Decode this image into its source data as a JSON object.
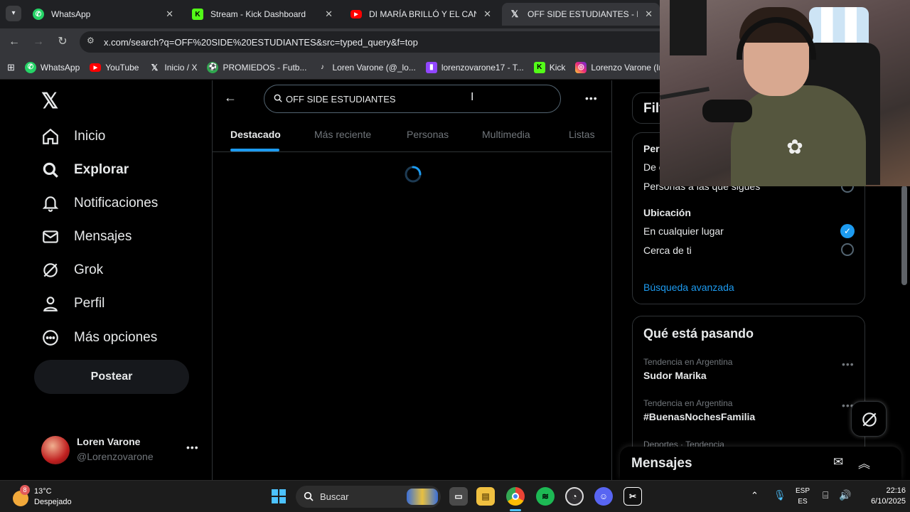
{
  "browser": {
    "tabs": [
      {
        "title": "WhatsApp",
        "favicon": "whatsapp-icon",
        "active": false
      },
      {
        "title": "Stream - Kick Dashboard",
        "favicon": "kick-icon",
        "active": false
      },
      {
        "title": "DI MARÍA BRILLÓ Y EL CANALL",
        "favicon": "youtube-icon",
        "active": false
      },
      {
        "title": "OFF SIDE ESTUDIANTES - Busc",
        "favicon": "x-icon",
        "active": true
      }
    ],
    "url": "x.com/search?q=OFF%20SIDE%20ESTUDIANTES&src=typed_query&f=top",
    "bookmarks": [
      {
        "label": "WhatsApp",
        "icon": "whatsapp-icon"
      },
      {
        "label": "YouTube",
        "icon": "youtube-icon"
      },
      {
        "label": "Inicio / X",
        "icon": "x-icon"
      },
      {
        "label": "PROMIEDOS - Futb...",
        "icon": "promiedos-icon"
      },
      {
        "label": "Loren Varone (@_lo...",
        "icon": "tiktok-icon"
      },
      {
        "label": "lorenzovarone17 - T...",
        "icon": "twitch-icon"
      },
      {
        "label": "Kick",
        "icon": "kick-icon"
      },
      {
        "label": "Lorenzo Varone (Inst...",
        "icon": "instagram-icon"
      }
    ]
  },
  "sidebar": {
    "nav": [
      {
        "label": "Inicio",
        "icon": "home-icon"
      },
      {
        "label": "Explorar",
        "icon": "search-icon"
      },
      {
        "label": "Notificaciones",
        "icon": "bell-icon"
      },
      {
        "label": "Mensajes",
        "icon": "mail-icon"
      },
      {
        "label": "Grok",
        "icon": "grok-icon"
      },
      {
        "label": "Perfil",
        "icon": "person-icon"
      },
      {
        "label": "Más opciones",
        "icon": "more-circle-icon"
      }
    ],
    "post_label": "Postear",
    "user": {
      "name": "Loren Varone",
      "handle": "@Lorenzovarone"
    }
  },
  "search": {
    "query": "OFF SIDE ESTUDIANTES",
    "tabs": [
      "Destacado",
      "Más reciente",
      "Personas",
      "Multimedia",
      "Listas"
    ],
    "active_tab": "Destacado"
  },
  "filters": {
    "title_visible": "Filt",
    "people_label_visible": "Pers",
    "people_option_1_visible": "De c",
    "people_option_2_visible": "Personas a las que sigues",
    "location_heading": "Ubicación",
    "location_options": [
      {
        "label": "En cualquier lugar",
        "selected": true
      },
      {
        "label": "Cerca de ti",
        "selected": false
      }
    ],
    "advanced_link": "Búsqueda avanzada"
  },
  "trending": {
    "title": "Qué está pasando",
    "items": [
      {
        "meta": "Tendencia en Argentina",
        "name": "Sudor Marika"
      },
      {
        "meta": "Tendencia en Argentina",
        "name": "#BuenasNochesFamilia"
      },
      {
        "meta": "Deportes · Tendencia",
        "name": ""
      }
    ]
  },
  "messages_drawer": {
    "title": "Mensajes"
  },
  "taskbar": {
    "weather": {
      "temp": "13°C",
      "condition": "Despejado",
      "badge": "8"
    },
    "search_label": "Buscar",
    "lang": {
      "top": "ESP",
      "bottom": "ES"
    },
    "time": "22:16",
    "date": "6/10/2025"
  },
  "colors": {
    "accent": "#1d9bf0",
    "background": "#000000",
    "border": "#2f3336",
    "muted": "#71767b"
  }
}
